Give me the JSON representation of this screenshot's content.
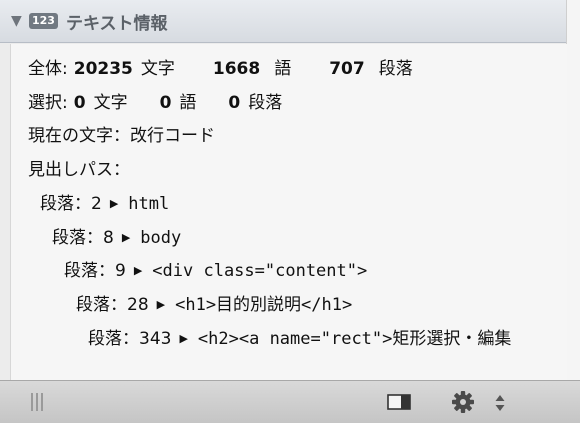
{
  "header": {
    "badge": "123",
    "title": "テキスト情報"
  },
  "stats": {
    "total_label": "全体:",
    "total_chars": "20235",
    "chars_unit": "文字",
    "total_words": "1668",
    "words_unit": "語",
    "total_paragraphs": "707",
    "paragraphs_unit": "段落",
    "selection_label": "選択:",
    "selection_chars": "0",
    "selection_words": "0",
    "selection_paragraphs": "0"
  },
  "current_char": {
    "label": "現在の文字：",
    "value": "改行コード"
  },
  "path": {
    "label": "見出しパス：",
    "items": [
      {
        "label": "段落：2",
        "tag": "html"
      },
      {
        "label": "段落：8",
        "tag": "body"
      },
      {
        "label": "段落：9",
        "tag": "<div class=\"content\">"
      },
      {
        "label": "段落：28",
        "tag": "<h1>目的別説明</h1>"
      },
      {
        "label": "段落：343",
        "tag": "<h2><a name=\"rect\">矩形選択・編集"
      }
    ]
  },
  "icons": {
    "disclosure": "triangle-down-icon",
    "grip": "grip-icon",
    "sidebar_toggle": "sidebar-toggle-icon",
    "gear": "gear-icon",
    "stepper": "up-down-arrows-icon"
  },
  "colors": {
    "header_bg": "#dde1e6",
    "content_bg": "#f6f6f6",
    "toolbar_bg": "#cfcfcf",
    "badge_bg": "#717982"
  }
}
